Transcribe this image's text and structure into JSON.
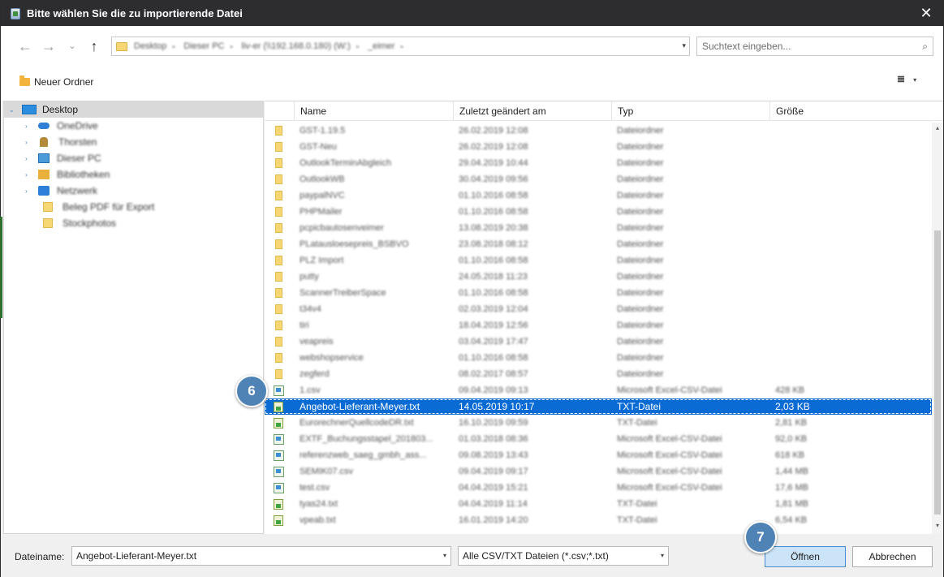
{
  "window": {
    "title": "Bitte wählen Sie die zu importierende Datei",
    "close_glyph": "✕"
  },
  "nav": {
    "back_glyph": "←",
    "forward_glyph": "→",
    "recent_glyph": "⌄",
    "up_glyph": "↑",
    "breadcrumbs": [
      "Desktop",
      "Dieser PC",
      "liv-er (\\\\192.168.0.180) (W:)",
      "_eimer"
    ],
    "crumb_sep": "»",
    "address_dropdown_glyph": "▾",
    "search_placeholder": "Suchtext eingeben...",
    "search_glyph": "⌕"
  },
  "toolbar": {
    "new_folder_label": "Neuer Ordner",
    "view_glyph": "≣",
    "view_dd_glyph": "▾"
  },
  "tree": {
    "expand_glyph": "›",
    "collapse_glyph": "⌄",
    "items": [
      {
        "label": "Desktop",
        "icon": "desktop-icon"
      },
      {
        "label": "OneDrive",
        "icon": "cloud-icon"
      },
      {
        "label": "Thorsten",
        "icon": "user-icon"
      },
      {
        "label": "Dieser PC",
        "icon": "pc-icon"
      },
      {
        "label": "Bibliotheken",
        "icon": "library-icon"
      },
      {
        "label": "Netzwerk",
        "icon": "network-icon"
      },
      {
        "label": "Beleg PDF für Export",
        "icon": "folder-icon"
      },
      {
        "label": "Stockphotos",
        "icon": "folder-icon"
      }
    ]
  },
  "columns": {
    "name": "Name",
    "date": "Zuletzt geändert am",
    "type": "Typ",
    "size": "Größe"
  },
  "files": [
    {
      "name": "GST-1.19.5",
      "date": "26.02.2019 12:08",
      "type": "Dateiordner",
      "size": "",
      "icon": "folder"
    },
    {
      "name": "GST-Neu",
      "date": "26.02.2019 12:08",
      "type": "Dateiordner",
      "size": "",
      "icon": "folder"
    },
    {
      "name": "OutlookTerminAbgleich",
      "date": "29.04.2019 10:44",
      "type": "Dateiordner",
      "size": "",
      "icon": "folder"
    },
    {
      "name": "OutlookWB",
      "date": "30.04.2019 09:56",
      "type": "Dateiordner",
      "size": "",
      "icon": "folder"
    },
    {
      "name": "paypalNVC",
      "date": "01.10.2016 08:58",
      "type": "Dateiordner",
      "size": "",
      "icon": "folder"
    },
    {
      "name": "PHPMailer",
      "date": "01.10.2016 08:58",
      "type": "Dateiordner",
      "size": "",
      "icon": "folder"
    },
    {
      "name": "pcpicbautosenveimer",
      "date": "13.08.2019 20:38",
      "type": "Dateiordner",
      "size": "",
      "icon": "folder"
    },
    {
      "name": "PLatausloesepreis_BSBVO",
      "date": "23.08.2018 08:12",
      "type": "Dateiordner",
      "size": "",
      "icon": "folder"
    },
    {
      "name": "PLZ Import",
      "date": "01.10.2016 08:58",
      "type": "Dateiordner",
      "size": "",
      "icon": "folder"
    },
    {
      "name": "putty",
      "date": "24.05.2018 11:23",
      "type": "Dateiordner",
      "size": "",
      "icon": "folder"
    },
    {
      "name": "ScannerTreiberSpace",
      "date": "01.10.2016 08:58",
      "type": "Dateiordner",
      "size": "",
      "icon": "folder"
    },
    {
      "name": "t34v4",
      "date": "02.03.2019 12:04",
      "type": "Dateiordner",
      "size": "",
      "icon": "folder"
    },
    {
      "name": "tiri",
      "date": "18.04.2019 12:56",
      "type": "Dateiordner",
      "size": "",
      "icon": "folder"
    },
    {
      "name": "veapreis",
      "date": "03.04.2019 17:47",
      "type": "Dateiordner",
      "size": "",
      "icon": "folder"
    },
    {
      "name": "webshopservice",
      "date": "01.10.2016 08:58",
      "type": "Dateiordner",
      "size": "",
      "icon": "folder"
    },
    {
      "name": "zegferd",
      "date": "08.02.2017 08:57",
      "type": "Dateiordner",
      "size": "",
      "icon": "folder"
    },
    {
      "name": "1.csv",
      "date": "09.04.2019 09:13",
      "type": "Microsoft Excel-CSV-Datei",
      "size": "428 KB",
      "icon": "csv"
    },
    {
      "name": "Angebot-Lieferant-Meyer.txt",
      "date": "14.05.2019 10:17",
      "type": "TXT-Datei",
      "size": "2,03 KB",
      "icon": "txt"
    },
    {
      "name": "EurorechnerQuellcodeDR.txt",
      "date": "16.10.2019 09:59",
      "type": "TXT-Datei",
      "size": "2,81 KB",
      "icon": "txt"
    },
    {
      "name": "EXTF_Buchungsstapel_201803...",
      "date": "01.03.2018 08:36",
      "type": "Microsoft Excel-CSV-Datei",
      "size": "92,0 KB",
      "icon": "csv"
    },
    {
      "name": "referenzweb_saeg_gmbh_ass...",
      "date": "09.08.2019 13:43",
      "type": "Microsoft Excel-CSV-Datei",
      "size": "618 KB",
      "icon": "csv"
    },
    {
      "name": "SEMIK07.csv",
      "date": "09.04.2019 09:17",
      "type": "Microsoft Excel-CSV-Datei",
      "size": "1,44 MB",
      "icon": "csv"
    },
    {
      "name": "test.csv",
      "date": "04.04.2019 15:21",
      "type": "Microsoft Excel-CSV-Datei",
      "size": "17,6 MB",
      "icon": "csv"
    },
    {
      "name": "tyas24.txt",
      "date": "04.04.2019 11:14",
      "type": "TXT-Datei",
      "size": "1,81 MB",
      "icon": "txt"
    },
    {
      "name": "vpeab.txt",
      "date": "16.01.2019 14:20",
      "type": "TXT-Datei",
      "size": "6,54 KB",
      "icon": "txt"
    }
  ],
  "selected_index": 17,
  "scroll": {
    "up_glyph": "▴",
    "down_glyph": "▾"
  },
  "footer": {
    "filename_label": "Dateiname:",
    "filename_value": "Angebot-Lieferant-Meyer.txt",
    "filter_value": "Alle CSV/TXT Dateien (*.csv;*.txt)",
    "dropdown_glyph": "▾",
    "open_label": "Öffnen",
    "cancel_label": "Abbrechen"
  },
  "callouts": {
    "step6": "6",
    "step7": "7"
  },
  "colors": {
    "titlebar": "#2d2d30",
    "selection": "#0b6bd4",
    "badge": "#4f83b5",
    "open_button": "#cce4f7"
  }
}
